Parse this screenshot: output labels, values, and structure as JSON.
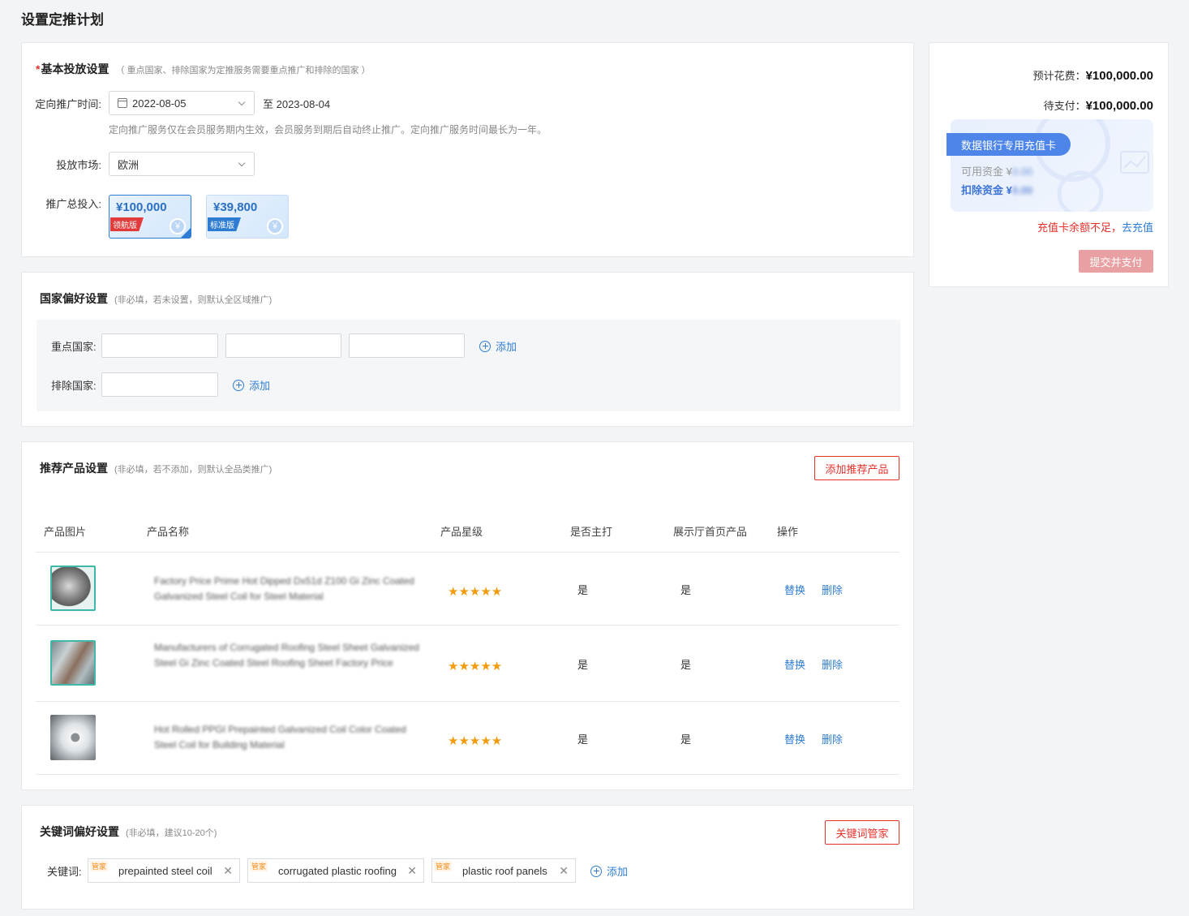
{
  "page": {
    "title": "设置定推计划"
  },
  "basic": {
    "required_mark": "*",
    "title": "基本投放设置",
    "hint": "（ 重点国家、排除国家为定推服务需要重点推广和排除的国家 ）",
    "time_label": "定向推广时间:",
    "start_date": "2022-08-05",
    "end_date": "至 2023-08-04",
    "time_note": "定向推广服务仅在会员服务期内生效，会员服务到期后自动终止推广。定向推广服务时间最长为一年。",
    "market_label": "投放市场:",
    "market_value": "欧洲",
    "budget_label": "推广总投入:",
    "plans": [
      {
        "amount": "¥100,000",
        "tag": "领航版",
        "tag_color": "#e23b3b",
        "selected": true
      },
      {
        "amount": "¥39,800",
        "tag": "标准版",
        "tag_color": "#2f7dd3",
        "selected": false
      }
    ]
  },
  "country": {
    "title": "国家偏好设置",
    "hint": "(非必填，若未设置，则默认全区域推广)",
    "focus_label": "重点国家:",
    "exclude_label": "排除国家:",
    "add_label": "添加"
  },
  "products": {
    "title": "推荐产品设置",
    "hint": "(非必填，若不添加，则默认全品类推广)",
    "add_button": "添加推荐产品",
    "columns": [
      "产品图片",
      "产品名称",
      "产品星级",
      "是否主打",
      "展示厅首页产品",
      "操作"
    ],
    "rows": [
      {
        "name": "Factory Price Prime Hot Dipped Dx51d Z100 Gi Zinc Coated Galvanized Steel Coil for Steel Material",
        "stars": "★★★★★",
        "main": "是",
        "showroom": "是",
        "replace": "替换",
        "delete": "删除"
      },
      {
        "name": "Manufacturers of Corrugated Roofing Steel Sheet Galvanized Steel Gi Zinc Coated Steel Roofing Sheet Factory Price",
        "stars": "★★★★★",
        "main": "是",
        "showroom": "是",
        "replace": "替换",
        "delete": "删除"
      },
      {
        "name": "Hot Rolled PPGI Prepainted Galvanized Coil Color Coated Steel Coil for Building Material",
        "stars": "★★★★★",
        "main": "是",
        "showroom": "是",
        "replace": "替换",
        "delete": "删除"
      }
    ]
  },
  "keywords": {
    "title": "关键词偏好设置",
    "hint": "(非必填，建议10-20个)",
    "manager_button": "关键词管家",
    "label": "关键词:",
    "badge": "管家",
    "items": [
      "prepainted steel coil",
      "corrugated plastic roofing",
      "plastic roof panels"
    ],
    "add_label": "添加"
  },
  "summary": {
    "est_label": "预计花费：",
    "est_value": "¥100,000.00",
    "pay_label": "待支付：",
    "pay_value": "¥100,000.00",
    "card_title": "数据银行专用充值卡",
    "available_label": "可用资金 ¥",
    "deduct_label": "扣除资金 ¥",
    "insufficient": "充值卡余额不足，",
    "recharge_link": "去充值",
    "submit": "提交并支付"
  }
}
